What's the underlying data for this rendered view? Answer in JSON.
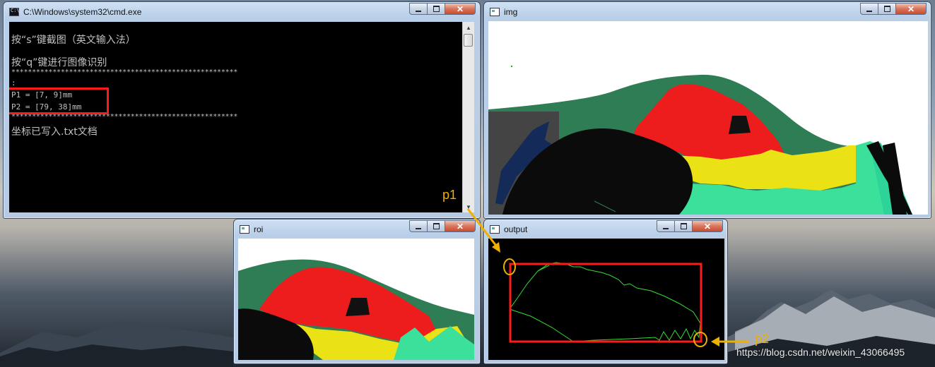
{
  "windows": {
    "cmd": {
      "title": "C:\\Windows\\system32\\cmd.exe"
    },
    "img": {
      "title": "img"
    },
    "roi": {
      "title": "roi"
    },
    "output": {
      "title": "output"
    }
  },
  "console": {
    "line1": "按“s”键截图（英文输入法）",
    "line2": "按“q”键进行图像识别",
    "stars": "*******************************************************",
    "colon": ":",
    "p1": "P1 = [7, 9]mm",
    "p2": "P2 = [79, 38]mm",
    "stars2": "*******************************************************",
    "done": "坐标已写入.txt文档"
  },
  "controls": {
    "minimize": "minimize",
    "maximize": "maximize",
    "close": "close"
  },
  "annotations": {
    "p1": "p1",
    "p2": "p2"
  },
  "watermark": "https://blog.csdn.net/weixin_43066495",
  "colors": {
    "highlight": "#ff1a1a",
    "annotation": "#f0b000",
    "contour": "#33dd33"
  },
  "icons": {
    "cmd": "console-icon",
    "window": "window-icon"
  }
}
